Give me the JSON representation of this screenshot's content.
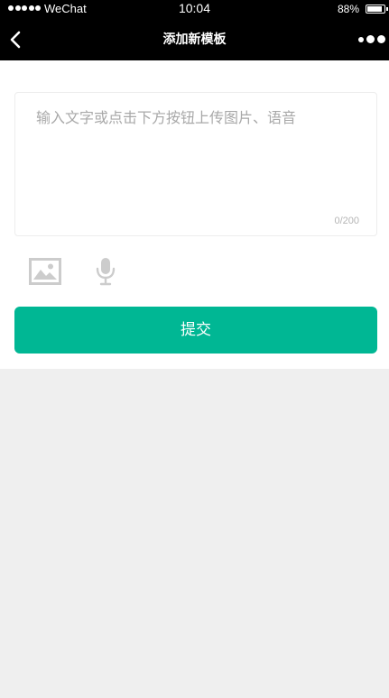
{
  "status_bar": {
    "carrier": "WeChat",
    "time": "10:04",
    "battery_percent": "88%",
    "battery_level": 0.88
  },
  "nav_bar": {
    "title": "添加新模板",
    "back_icon": "chevron-left-icon",
    "more_icon": "more-dots-icon"
  },
  "editor": {
    "placeholder": "输入文字或点击下方按钮上传图片、语音",
    "value": "",
    "counter": "0/200"
  },
  "toolbar": {
    "image_icon": "image-icon",
    "voice_icon": "microphone-icon"
  },
  "submit_label": "提交",
  "colors": {
    "accent": "#00b794",
    "nav_background": "#000000",
    "page_background": "#efefef",
    "icon_gray": "#cccccc"
  }
}
